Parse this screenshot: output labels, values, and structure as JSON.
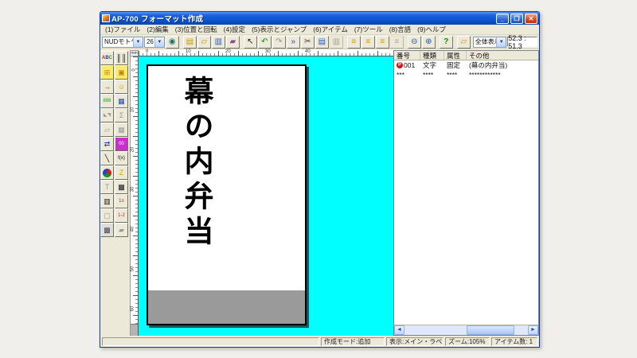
{
  "window": {
    "title": "AP-700 フォーマット作成",
    "controls": {
      "minimize": "_",
      "maximize": "❐",
      "close": "✕"
    }
  },
  "menu": {
    "items": [
      {
        "label": "(1)ファイル"
      },
      {
        "label": "(2)編集"
      },
      {
        "label": "(3)位置と回転"
      },
      {
        "label": "(4)設定"
      },
      {
        "label": "(5)表示とジャンプ"
      },
      {
        "label": "(6)アイテム"
      },
      {
        "label": "(7)ツール"
      },
      {
        "label": "(8)言語"
      },
      {
        "label": "(9)ヘルプ"
      }
    ]
  },
  "toolbar": {
    "font_select": {
      "value": "NUDモトヤEX明朝"
    },
    "size_select": {
      "value": "26"
    },
    "view_select": {
      "value": "全体表示"
    },
    "coordinates": "52.3 : 51.3",
    "buttons": [
      {
        "name": "settings-globe-icon",
        "glyph": "◉",
        "color": "#1d6f6f"
      },
      {
        "name": "new-document-icon",
        "glyph": "▤",
        "color": "#c89b00",
        "gap": true
      },
      {
        "name": "open-folder-icon",
        "glyph": "▱",
        "color": "#c89b00"
      },
      {
        "name": "save-pages-icon",
        "glyph": "▥",
        "color": "#2d55bb"
      },
      {
        "name": "export-folder-icon",
        "glyph": "▰",
        "color": "#8a4a9e"
      },
      {
        "name": "select-cursor-icon",
        "glyph": "↖",
        "color": "#111111",
        "gap": true
      },
      {
        "name": "undo-icon",
        "glyph": "↶",
        "color": "#128a12"
      },
      {
        "name": "redo-icon",
        "glyph": "↷",
        "color": "#7f9f7f"
      },
      {
        "name": "jump-item-icon",
        "glyph": "»",
        "color": "#2244cc"
      },
      {
        "name": "cut-icon",
        "glyph": "✂",
        "color": "#333333"
      },
      {
        "name": "copy-icon",
        "glyph": "▤",
        "color": "#2255cc"
      },
      {
        "name": "paste-icon",
        "glyph": "▥",
        "color": "#9a9a9a",
        "disabled": true
      },
      {
        "name": "item-list-add-icon",
        "glyph": "≡",
        "color": "#c89b00",
        "gap": true
      },
      {
        "name": "item-list-edit-icon",
        "glyph": "≡",
        "color": "#c89b00"
      },
      {
        "name": "item-list-copy-icon",
        "glyph": "≡",
        "color": "#c89b00"
      },
      {
        "name": "item-list-clear-icon",
        "glyph": "≡",
        "color": "#9a9a9a",
        "disabled": true
      },
      {
        "name": "zoom-out-icon",
        "glyph": "⊖",
        "color": "#2255cc",
        "gap": true
      },
      {
        "name": "zoom-in-icon",
        "glyph": "⊕",
        "color": "#2255cc"
      },
      {
        "name": "help-icon",
        "glyph": "?",
        "color": "#128a12",
        "gap": true
      },
      {
        "name": "import-format-icon",
        "glyph": "▱",
        "color": "#c89b00",
        "gap": true
      }
    ]
  },
  "palette": {
    "buttons": [
      {
        "name": "text-item-icon",
        "glyph": "ABC",
        "abc": true
      },
      {
        "name": "barcode-item-icon",
        "glyph": "║║",
        "color": "#111111"
      },
      {
        "name": "table-item-icon",
        "glyph": "⊞",
        "color": "#b58a00",
        "bg": "#ffe96a"
      },
      {
        "name": "print-machine-icon",
        "glyph": "▣",
        "color": "#b58a00",
        "bg": "#ffe96a"
      },
      {
        "name": "url-arrow-icon",
        "glyph": "→",
        "color": "#cc1111"
      },
      {
        "name": "smiley-icon",
        "glyph": "☺",
        "color": "#d9a400"
      },
      {
        "name": "counter-888-icon",
        "glyph": "888",
        "color": "#18a018",
        "small": true
      },
      {
        "name": "calculator-icon",
        "glyph": "▦",
        "color": "#2244bb"
      },
      {
        "name": "flip-tool-icon",
        "glyph": "◣◥",
        "color": "#9a9a9a",
        "disabled": true,
        "small": true
      },
      {
        "name": "sum-tool-icon",
        "glyph": "Σ",
        "color": "#9a9a9a",
        "disabled": true
      },
      {
        "name": "layers-tool-icon",
        "glyph": "▱",
        "color": "#9a9a9a",
        "disabled": true
      },
      {
        "name": "grid-tool-icon",
        "glyph": "▦",
        "color": "#9a9a9a",
        "disabled": true
      },
      {
        "name": "move-item-icon",
        "glyph": "⇄",
        "color": "#2233aa"
      },
      {
        "name": "double-zero-icon",
        "glyph": "00",
        "color": "#ffffff",
        "bg": "#cc2ecc",
        "small": true
      },
      {
        "name": "line-item-icon",
        "glyph": "╲",
        "color": "#111111"
      },
      {
        "name": "formula-icon",
        "glyph": "f(x)",
        "color": "#111111",
        "small": true
      },
      {
        "name": "pie-chart-icon",
        "glyph": "",
        "pie": true
      },
      {
        "name": "polygon-icon",
        "glyph": "Z",
        "color": "#d9a400"
      },
      {
        "name": "text-scale-icon",
        "glyph": "T",
        "color": "#9a9a9a",
        "disabled": true
      },
      {
        "name": "qr-code-icon",
        "glyph": "▩",
        "color": "#111111"
      },
      {
        "name": "barcode2-item-icon",
        "glyph": "▥",
        "color": "#111111"
      },
      {
        "name": "numbered-list-icon",
        "glyph": "1≡",
        "color": "#cc2222",
        "small": true
      },
      {
        "name": "frame-item-icon",
        "glyph": "▢",
        "color": "#9a9a9a"
      },
      {
        "name": "sequence-list-icon",
        "glyph": "1-2",
        "color": "#cc2222",
        "small": true
      },
      {
        "name": "pattern-image-icon",
        "glyph": "▩",
        "color": "#444444",
        "bg": "#dddddd"
      },
      {
        "name": "box-3d-icon",
        "glyph": "▰",
        "color": "#9a9a9a",
        "disabled": true
      }
    ]
  },
  "rulers": {
    "unit": "mm",
    "horizontal_ticks": [
      "0",
      "10",
      "20",
      "30",
      "40"
    ],
    "vertical_ticks": [
      "0",
      "10",
      "20",
      "30",
      "40",
      "50",
      "60"
    ]
  },
  "canvas": {
    "label_text": "幕の内弁当",
    "background": "#00ffff",
    "label_background": "#ffffff",
    "band_color": "#9a9a9a"
  },
  "item_list": {
    "columns": [
      "番号",
      "種類",
      "属性",
      "その他"
    ],
    "rows": [
      {
        "marker": "P",
        "number": "001",
        "type": "文字",
        "attr": "固定",
        "other": "(幕の内弁当)"
      },
      {
        "marker": "",
        "number": "***",
        "type": "****",
        "attr": "****",
        "other": "************"
      }
    ]
  },
  "status": {
    "segments": [
      "",
      "作成モード:追加",
      "表示:メイン・ラベル",
      "ズーム:105%",
      "アイテム数: 1"
    ]
  },
  "colors": {
    "titlebar": "#0b51cc",
    "chrome": "#ece9d8",
    "canvas_cyan": "#00ffff",
    "marker_red": "#d31010"
  }
}
